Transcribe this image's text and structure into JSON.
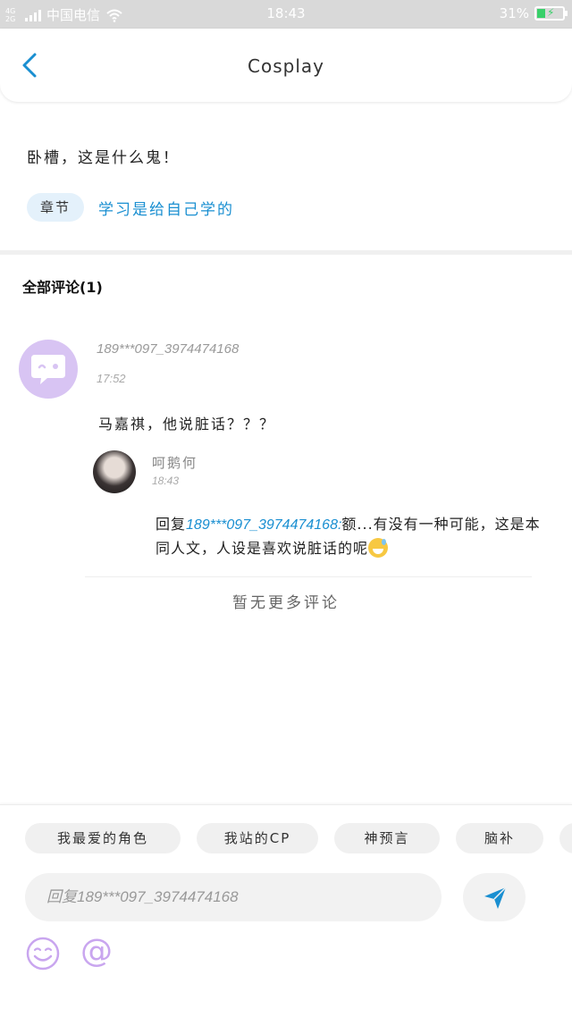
{
  "status_bar": {
    "net_badge": "4G 2G",
    "carrier": "中国电信",
    "time": "18:43",
    "battery_percent": "31%",
    "battery_level": 0.31,
    "battery_color": "#39d06a"
  },
  "nav": {
    "back_icon": "chevron-left-icon",
    "title": "Cosplay",
    "accent": "#1a8fd1"
  },
  "post": {
    "text": "卧槽，这是什么鬼！",
    "chapter_tag": "章节",
    "chapter_title": "学习是给自己学的"
  },
  "comments": {
    "header": "全部评论(1)",
    "items": [
      {
        "username": "189***097_3974474168",
        "time": "17:52",
        "avatar_icon": "wink-chat-bubble-icon",
        "text": "马嘉祺，他说脏话？？？",
        "replies": [
          {
            "username": "呵鹅何",
            "time": "18:43",
            "reply_prefix": "回复",
            "mention": "189***097_3974474168:",
            "text": "额...有没有一种可能，这是本同人文，人设是喜欢说脏话的呢",
            "emoji": "sweat-smile-emoji"
          }
        ]
      }
    ],
    "no_more": "暂无更多评论"
  },
  "input_bar": {
    "chips": [
      "我最爱的角色",
      "我站的CP",
      "神预言",
      "脑补"
    ],
    "placeholder": "回复189***097_3974474168",
    "send_icon": "paper-plane-icon",
    "emoji_icon": "smiley-icon",
    "at_icon": "@",
    "icon_color": "#c9a6ef"
  }
}
